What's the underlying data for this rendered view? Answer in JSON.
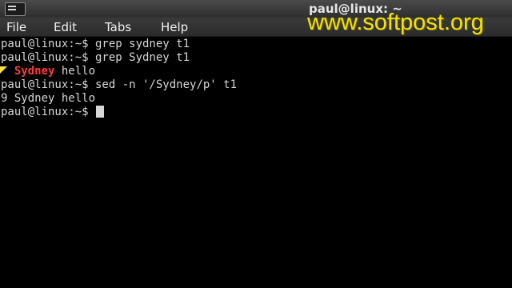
{
  "window": {
    "title": "paul@linux: ~"
  },
  "watermark": {
    "text": "www.softpost.org"
  },
  "menu": [
    {
      "label": "File"
    },
    {
      "label": "Edit"
    },
    {
      "label": "Tabs"
    },
    {
      "label": "Help"
    }
  ],
  "terminal": {
    "lines": [
      {
        "prompt": "paul@linux:~$",
        "command": " grep sydney t1"
      },
      {
        "prompt": "paul@linux:~$",
        "command": " grep Sydney t1"
      },
      {
        "prefix": "  ",
        "match": "Sydney",
        "rest": " hello"
      },
      {
        "prompt": "paul@linux:~$",
        "command": " sed -n '/Sydney/p' t1"
      },
      {
        "output": "9 Sydney hello"
      },
      {
        "prompt": "paul@linux:~$",
        "command": " "
      }
    ]
  },
  "colors": {
    "match_highlight": "#ff3b3b",
    "watermark": "#f2e200",
    "terminal_bg": "#000000",
    "terminal_fg": "#d6d6d6"
  },
  "icons": {
    "app": "terminal-icon",
    "pointer": "mouse-pointer-icon"
  }
}
